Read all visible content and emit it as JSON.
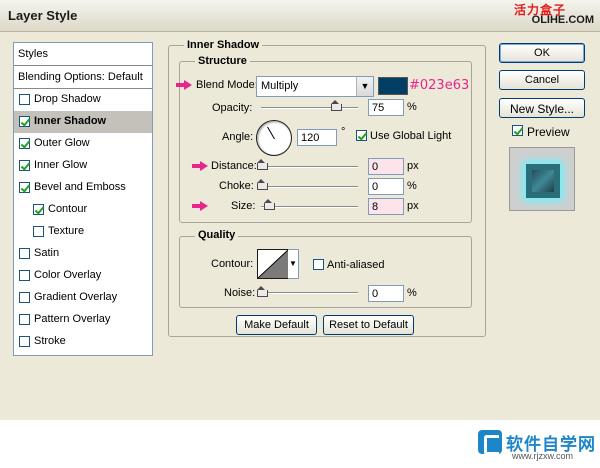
{
  "window": {
    "title": "Layer Style",
    "watermark_cn": "活力盒子",
    "watermark_en": "OLIHE.COM"
  },
  "styles_panel": {
    "header": "Styles",
    "blending": "Blending Options: Default",
    "items": [
      {
        "label": "Drop Shadow",
        "checked": false
      },
      {
        "label": "Inner Shadow",
        "checked": true,
        "selected": true
      },
      {
        "label": "Outer Glow",
        "checked": true
      },
      {
        "label": "Inner Glow",
        "checked": true
      },
      {
        "label": "Bevel and Emboss",
        "checked": true
      },
      {
        "label": "Contour",
        "checked": true,
        "sub": true
      },
      {
        "label": "Texture",
        "checked": false,
        "sub": true
      },
      {
        "label": "Satin",
        "checked": false
      },
      {
        "label": "Color Overlay",
        "checked": false
      },
      {
        "label": "Gradient Overlay",
        "checked": false
      },
      {
        "label": "Pattern Overlay",
        "checked": false
      },
      {
        "label": "Stroke",
        "checked": false
      }
    ]
  },
  "inner_shadow": {
    "title": "Inner Shadow",
    "structure": {
      "title": "Structure",
      "blend_mode_label": "Blend Mode:",
      "blend_mode_value": "Multiply",
      "color": "#023e63",
      "color_hex_note": "#023e63",
      "opacity_label": "Opacity:",
      "opacity_value": "75",
      "opacity_unit": "%",
      "opacity_level": 0.75,
      "angle_label": "Angle:",
      "angle_value": "120",
      "angle_unit": "°",
      "global_light_label": "Use Global Light",
      "global_light_checked": true,
      "distance_label": "Distance:",
      "distance_value": "0",
      "distance_unit": "px",
      "choke_label": "Choke:",
      "choke_value": "0",
      "choke_unit": "%",
      "size_label": "Size:",
      "size_value": "8",
      "size_unit": "px"
    },
    "quality": {
      "title": "Quality",
      "contour_label": "Contour:",
      "anti_aliased_label": "Anti-aliased",
      "anti_aliased_checked": false,
      "noise_label": "Noise:",
      "noise_value": "0",
      "noise_unit": "%"
    },
    "make_default": "Make Default",
    "reset_default": "Reset to Default"
  },
  "side_buttons": {
    "ok": "OK",
    "cancel": "Cancel",
    "new_style": "New Style...",
    "preview_label": "Preview",
    "preview_checked": true
  },
  "footer_logo": {
    "cn": "软件自学网",
    "url": "www.rjzxw.com"
  },
  "colors": {
    "accent_pink": "#e8258a",
    "shadow_color": "#023e63",
    "glow": "#6cf3ff"
  }
}
